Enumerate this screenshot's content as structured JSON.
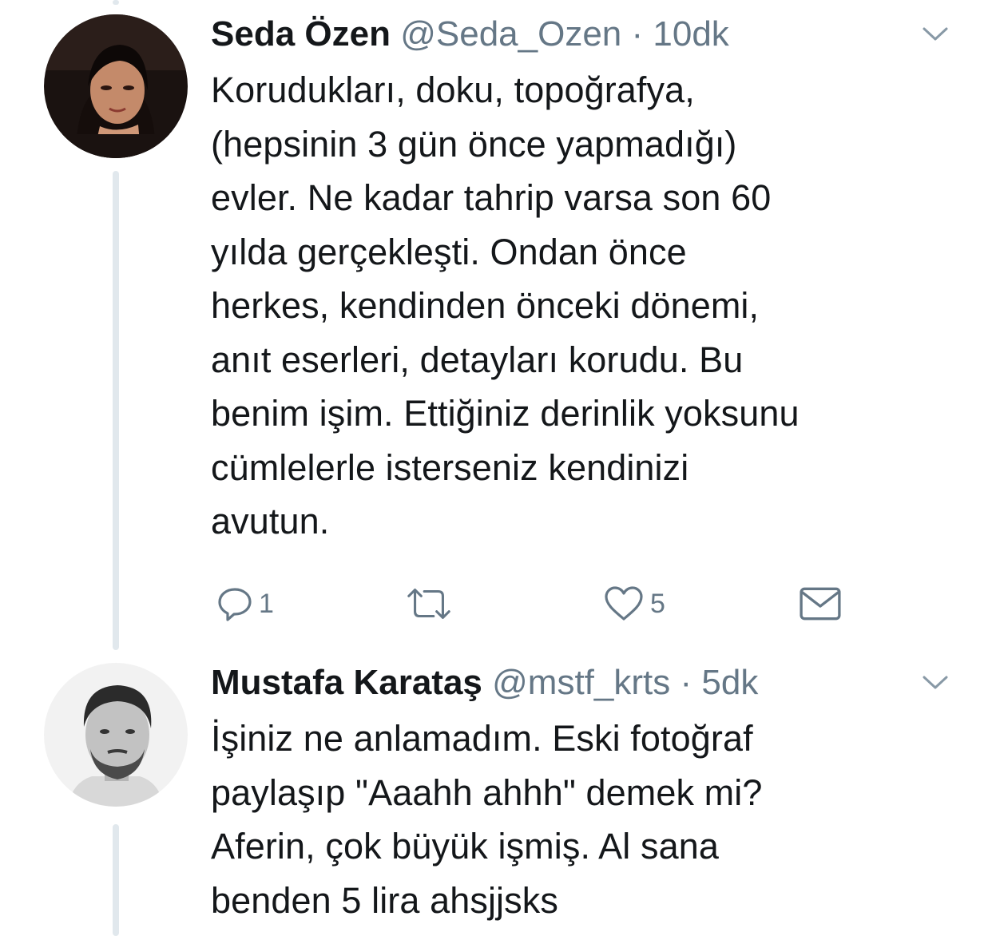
{
  "tweets": [
    {
      "name": "Seda Özen",
      "handle": "@Seda_Ozen",
      "dot": "·",
      "time": "10dk",
      "lines": [
        "Korudukları, doku, topoğrafya,",
        "(hepsinin 3  gün önce yapmadığı)",
        "evler. Ne kadar tahrip varsa son 60",
        "yılda gerçekleşti. Ondan önce",
        "herkes, kendinden önceki dönemi,",
        "anıt eserleri, detayları korudu. Bu",
        "benim işim. Ettiğiniz derinlik yoksunu",
        "cümlelerle isterseniz kendinizi",
        "avutun."
      ],
      "reply_count": "1",
      "like_count": "5"
    },
    {
      "name": "Mustafa Karataş",
      "handle": "@mstf_krts",
      "dot": "·",
      "time": "5dk",
      "lines": [
        "İşiniz ne anlamadım. Eski fotoğraf",
        "paylaşıp \"Aaahh ahhh\" demek mi?",
        "Aferin, çok büyük işmiş. Al sana",
        "benden 5 lira ahsjjsks"
      ]
    }
  ],
  "colors": {
    "text": "#14171a",
    "secondary": "#657786",
    "thread_line": "#e1e8ed"
  },
  "icons": [
    "chevron-down-icon",
    "reply-icon",
    "retweet-icon",
    "like-icon",
    "dm-envelope-icon"
  ]
}
